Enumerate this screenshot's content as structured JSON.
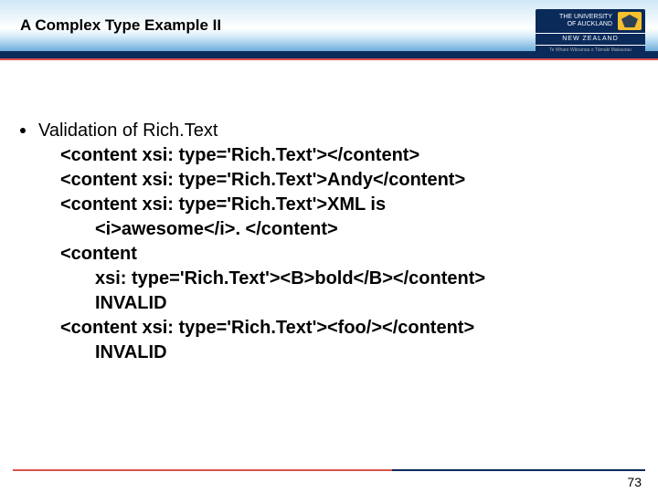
{
  "header": {
    "title": "A Complex Type Example II",
    "logo": {
      "line1": "THE UNIVERSITY",
      "line2": "OF AUCKLAND",
      "mid": "NEW ZEALAND",
      "maori": "Te Whare Wānanga o Tāmaki Makaurau"
    }
  },
  "bullet": "Validation of Rich.Text",
  "lines": {
    "l1": "<content xsi: type='Rich.Text'></content>",
    "l2": "<content xsi: type='Rich.Text'>Andy</content>",
    "l3": "<content xsi: type='Rich.Text'>XML is",
    "l3b": "<i>awesome</i>. </content>",
    "l4": "<content",
    "l4b": "xsi: type='Rich.Text'><B>bold</B></content>",
    "l4c": "INVALID",
    "l5": "<content xsi: type='Rich.Text'><foo/></content>",
    "l5b": "INVALID"
  },
  "page": "73"
}
